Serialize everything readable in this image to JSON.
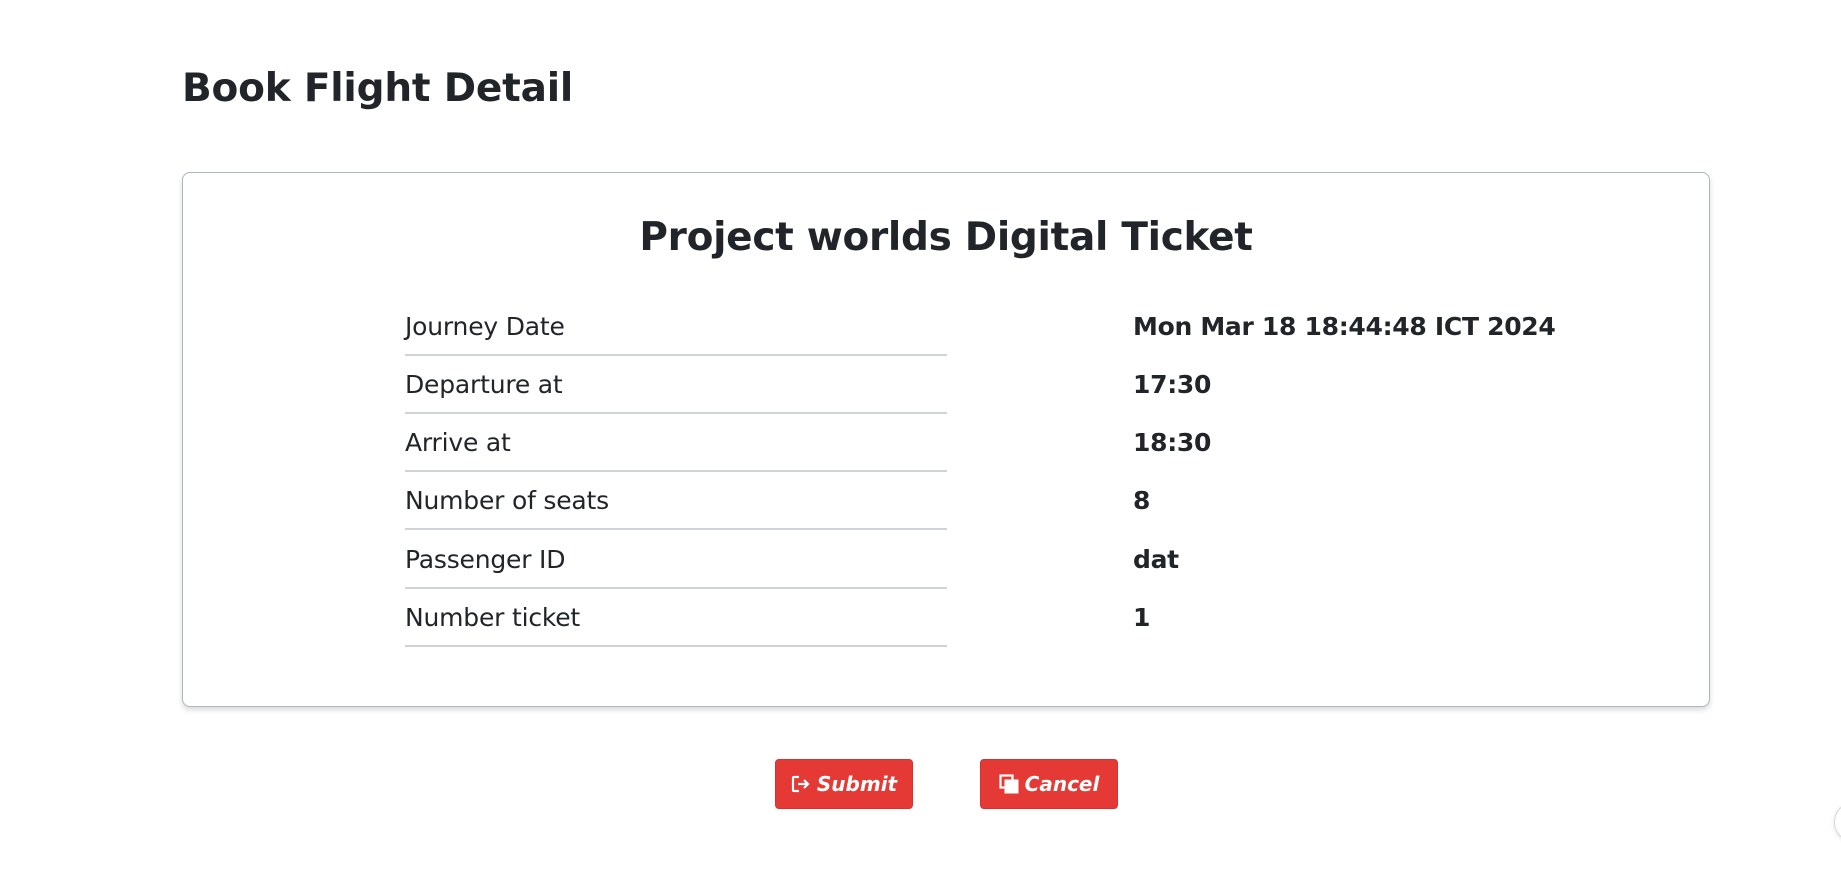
{
  "page": {
    "heading": "Book Flight Detail"
  },
  "ticket": {
    "title": "Project worlds Digital Ticket",
    "rows": [
      {
        "label": "Journey Date",
        "value": "Mon Mar 18 18:44:48 ICT 2024"
      },
      {
        "label": "Departure at",
        "value": "17:30"
      },
      {
        "label": "Arrive at",
        "value": "18:30"
      },
      {
        "label": "Number of seats",
        "value": "8"
      },
      {
        "label": "Passenger ID",
        "value": "dat"
      },
      {
        "label": "Number ticket",
        "value": "1"
      }
    ]
  },
  "actions": {
    "submit_label": "Submit",
    "submit_icon": "sign-out-icon",
    "cancel_label": "Cancel",
    "cancel_icon": "clone-icon",
    "button_color": "#e53935"
  }
}
